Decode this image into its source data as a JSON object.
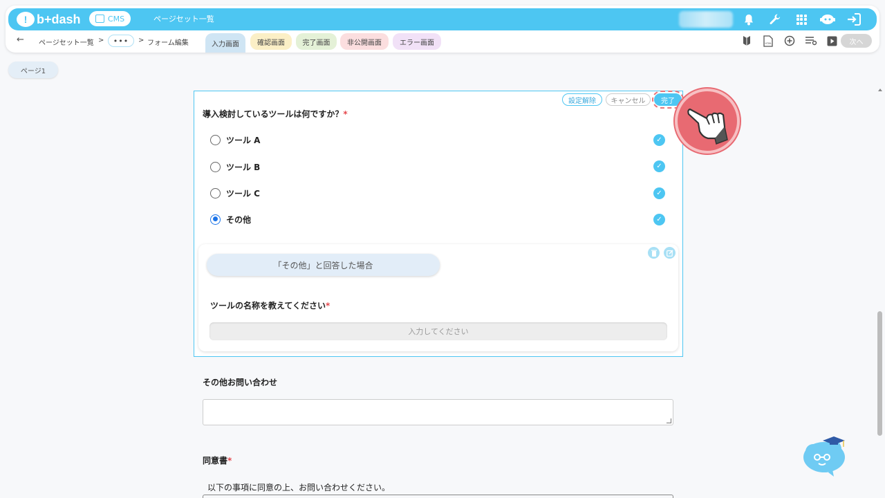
{
  "header": {
    "logo_text": "b+dash",
    "cms_label": "CMS",
    "page_title": "ページセット一覧",
    "icons": [
      "bell-icon",
      "wrench-icon",
      "grid-icon",
      "robot-icon",
      "logout-icon"
    ]
  },
  "breadcrumb": {
    "back": "←",
    "item1": "ページセット一覧",
    "sep": ">",
    "ellipsis": "•••",
    "item3": "フォーム編集"
  },
  "tabs": [
    {
      "label": "入力画面",
      "color": "#cfe5f4",
      "active": true
    },
    {
      "label": "確認画面",
      "color": "#fbefc6"
    },
    {
      "label": "完了画面",
      "color": "#e4f1d7"
    },
    {
      "label": "非公開画面",
      "color": "#fbdedf"
    },
    {
      "label": "エラー画面",
      "color": "#f1e1f7"
    }
  ],
  "toolbar": {
    "next_label": "次へ",
    "icons": [
      "beginner-mark-icon",
      "html-file-icon",
      "add-circle-icon",
      "list-settings-icon",
      "play-icon"
    ]
  },
  "page_pill": "ページ1",
  "edit_actions": {
    "unset": "設定解除",
    "cancel": "キャンセル",
    "done": "完了"
  },
  "question": {
    "label": "導入検討しているツールは何ですか？",
    "required_mark": "*",
    "options": [
      {
        "label": "ツール A",
        "selected": false
      },
      {
        "label": "ツール B",
        "selected": false
      },
      {
        "label": "ツール C",
        "selected": false
      },
      {
        "label": "その他",
        "selected": true
      }
    ]
  },
  "condition": {
    "label": "「その他」と回答した場合",
    "sub_question": "ツールの名称を教えてください",
    "required_mark": "*",
    "placeholder": "入力してください"
  },
  "other_inquiry": {
    "label": "その他お問い合わせ"
  },
  "consent": {
    "label": "同意書",
    "required_mark": "*",
    "text": "以下の事項に同意の上、お問い合わせください。"
  },
  "colors": {
    "accent": "#4dc6f2",
    "required": "#e5484d",
    "pointer": "#e86a72"
  }
}
